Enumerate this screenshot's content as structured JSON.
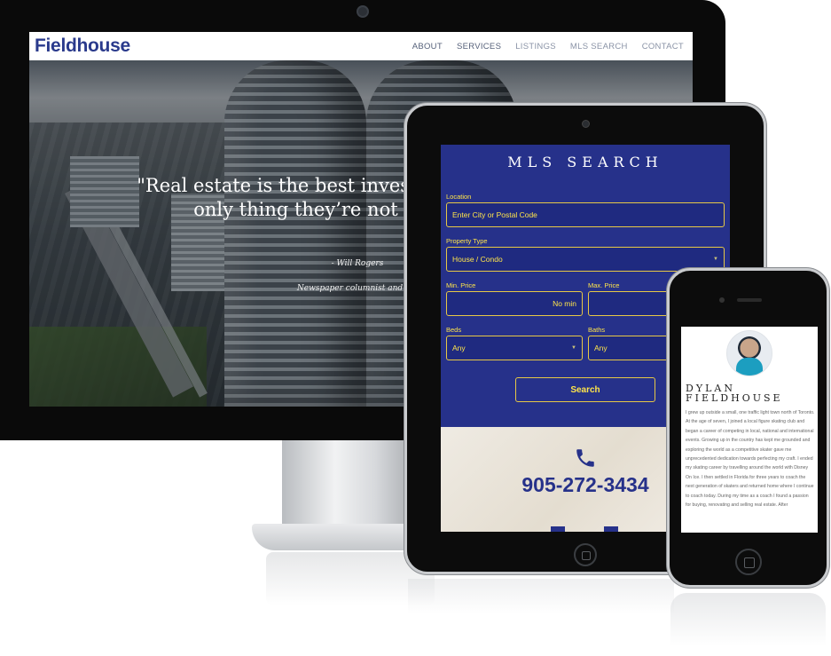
{
  "desktop": {
    "site": {
      "brand": "Fieldhouse",
      "nav": [
        {
          "label": "ABOUT"
        },
        {
          "label": "SERVICES"
        },
        {
          "label": "LISTINGS"
        },
        {
          "label": "MLS SEARCH"
        },
        {
          "label": "CONTACT"
        }
      ]
    },
    "hero": {
      "quote_line1": "\"Real estate is the best investment in",
      "quote_line2": "only thing they’re not ma",
      "author": "- Will Rogers",
      "role": "Newspaper columnist and social c"
    }
  },
  "tablet": {
    "title": "MLS SEARCH",
    "location": {
      "label": "Location",
      "placeholder": "Enter City or Postal Code"
    },
    "property_type": {
      "label": "Property Type",
      "value": "House / Condo"
    },
    "min_price": {
      "label": "Min. Price",
      "value": "No min"
    },
    "max_price": {
      "label": "Max. Price",
      "value": ""
    },
    "beds": {
      "label": "Beds",
      "value": "Any"
    },
    "baths": {
      "label": "Baths",
      "value": "Any"
    },
    "search_button": "Search",
    "phone": "905-272-3434",
    "icons": [
      "phone-icon"
    ]
  },
  "phone_device": {
    "name_line1": "DYLAN",
    "name_line2": "FIELDHOUSE",
    "bio": "I grew up outside a small, one traffic light town north of Toronto. At the age of seven, I joined a local figure skating club and began a career of competing in local, national and international events. Growing up in the country has kept me grounded and exploring the world as a competitive skater gave me unprecedented dedication towards perfecting my craft. I ended my skating career by travelling around the world with Disney On Ice. I then settled in Florida for three years to coach the next generation of skaters and returned home where I continue to coach today. During my time as a coach I found a passion for buying, renovating and selling real estate. After"
  },
  "colors": {
    "brand_navy": "#2a3a8c",
    "form_blue": "#26318a",
    "accent_yellow": "#ffe54a"
  }
}
